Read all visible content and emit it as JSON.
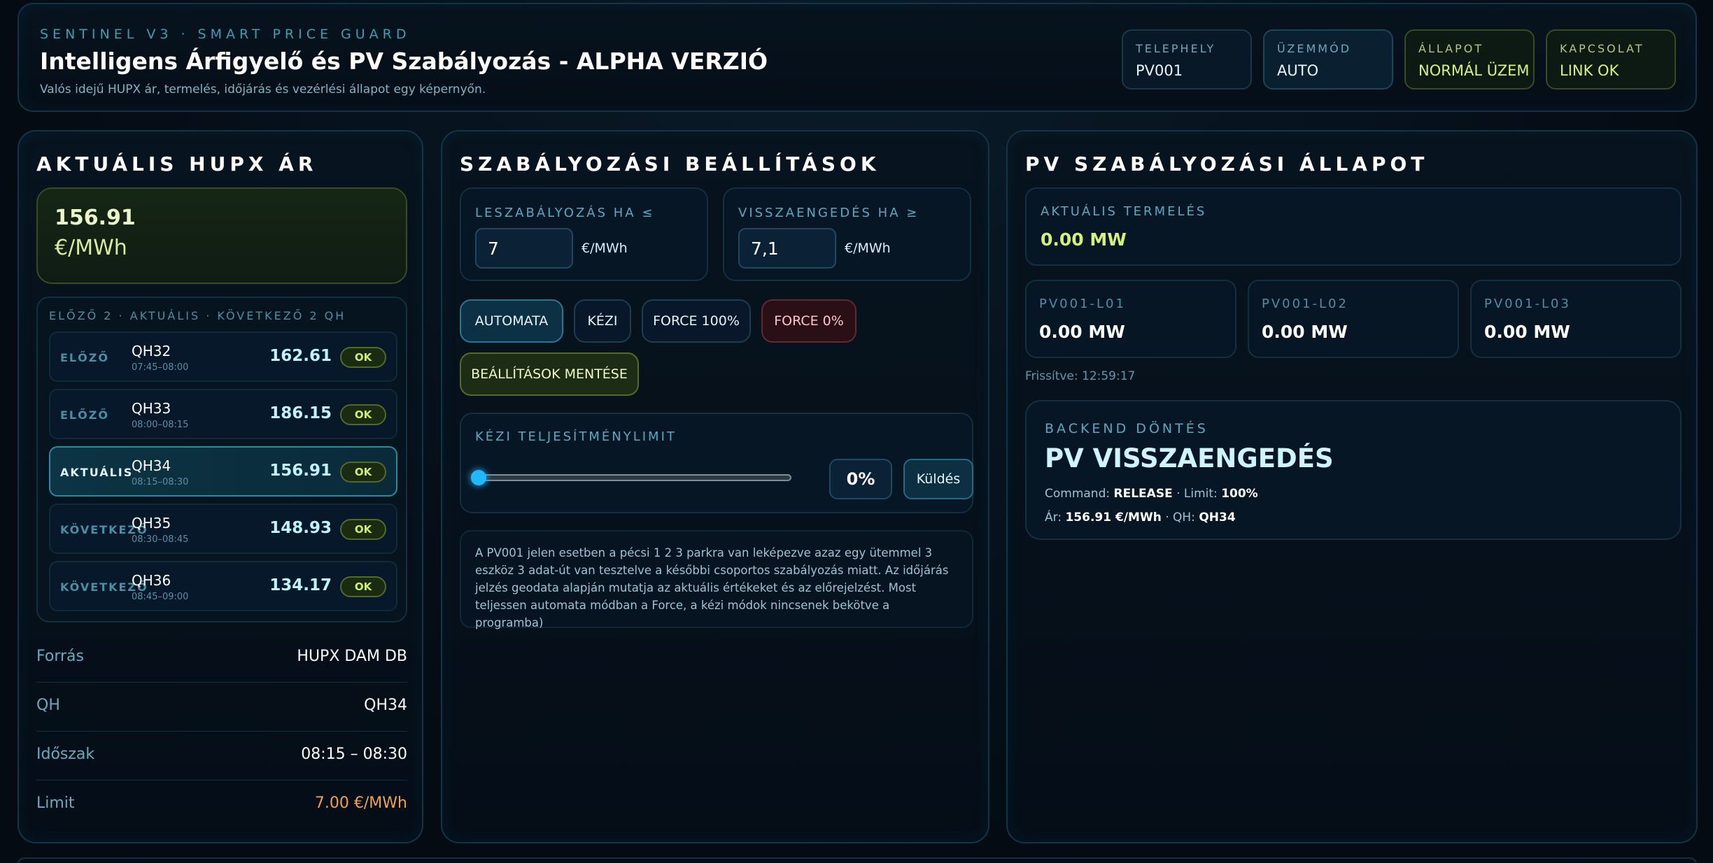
{
  "header": {
    "eyebrow": "SENTINEL V3 · SMART PRICE GUARD",
    "title": "Intelligens Árfigyelő és PV Szabályozás - ALPHA VERZIÓ",
    "subtitle": "Valós idejű HUPX ár, termelés, időjárás és vezérlési állapot egy képernyőn.",
    "chips": [
      {
        "label": "TELEPHELY",
        "value": "PV001"
      },
      {
        "label": "ÜZEMMÓD",
        "value": "AUTO"
      },
      {
        "label": "ÁLLAPOT",
        "value": "NORMÁL ÜZEM"
      },
      {
        "label": "KAPCSOLAT",
        "value": "LINK OK"
      }
    ]
  },
  "price": {
    "title": "AKTUÁLIS HUPX ÁR",
    "value": "156.91",
    "unit": "€/MWh",
    "list_header": "ELŐZŐ 2 · AKTUÁLIS · KÖVETKEZŐ 2 QH",
    "rows": [
      {
        "tag": "ELŐZŐ",
        "qh": "QH32",
        "time": "07:45–08:00",
        "value": "162.61",
        "status": "OK"
      },
      {
        "tag": "ELŐZŐ",
        "qh": "QH33",
        "time": "08:00–08:15",
        "value": "186.15",
        "status": "OK"
      },
      {
        "tag": "AKTUÁLIS",
        "qh": "QH34",
        "time": "08:15–08:30",
        "value": "156.91",
        "status": "OK"
      },
      {
        "tag": "KÖVETKEZŐ",
        "qh": "QH35",
        "time": "08:30–08:45",
        "value": "148.93",
        "status": "OK"
      },
      {
        "tag": "KÖVETKEZŐ",
        "qh": "QH36",
        "time": "08:45–09:00",
        "value": "134.17",
        "status": "OK"
      }
    ],
    "details": [
      {
        "key": "Forrás",
        "value": "HUPX DAM DB"
      },
      {
        "key": "QH",
        "value": "QH34"
      },
      {
        "key": "Időszak",
        "value": "08:15 – 08:30"
      },
      {
        "key": "Limit",
        "value": "7.00 €/MWh"
      }
    ]
  },
  "settings": {
    "title": "SZABÁLYOZÁSI BEÁLLÍTÁSOK",
    "curtail_label": "LESZABÁLYOZÁS HA ≤",
    "curtail_value": "7",
    "release_label": "VISSZAENGEDÉS HA ≥",
    "release_value": "7,1",
    "unit": "€/MWh",
    "modes": [
      "AUTOMATA",
      "KÉZI",
      "FORCE 100%",
      "FORCE 0%"
    ],
    "active_mode": "AUTOMATA",
    "save_label": "BEÁLLÍTÁSOK MENTÉSE",
    "manual_label": "KÉZI TELJESÍTMÉNYLIMIT",
    "manual_fraction": 0,
    "manual_value": "0%",
    "send_label": "Küldés",
    "note": "A PV001 jelen esetben a pécsi 1 2 3 parkra van leképezve azaz egy ütemmel 3 eszköz 3 adat-út van tesztelve a későbbi csoportos szabályozás miatt. Az időjárás jelzés geodata alapján mutatja az aktuális értékeket és az előrejelzést. Most teljessen automata módban a Force, a kézi módok nincsenek bekötve a programba)"
  },
  "status": {
    "title": "PV SZABÁLYOZÁSI ÁLLAPOT",
    "production_label": "AKTUÁLIS TERMELÉS",
    "production_value": "0.00 MW",
    "units": [
      {
        "label": "PV001-L01",
        "value": "0.00 MW"
      },
      {
        "label": "PV001-L02",
        "value": "0.00 MW"
      },
      {
        "label": "PV001-L03",
        "value": "0.00 MW"
      }
    ],
    "refreshed": "Frissítve: 12:59:17",
    "decision_label": "BACKEND DÖNTÉS",
    "decision_value": "PV VISSZAENGEDÉS",
    "command_key": "Command:",
    "command_value": "RELEASE",
    "limit_key": "Limit:",
    "limit_value": "100%",
    "price_key": "Ár:",
    "price_value": "156.91 €/MWh",
    "qh_key": "QH:",
    "qh_value": "QH34"
  }
}
